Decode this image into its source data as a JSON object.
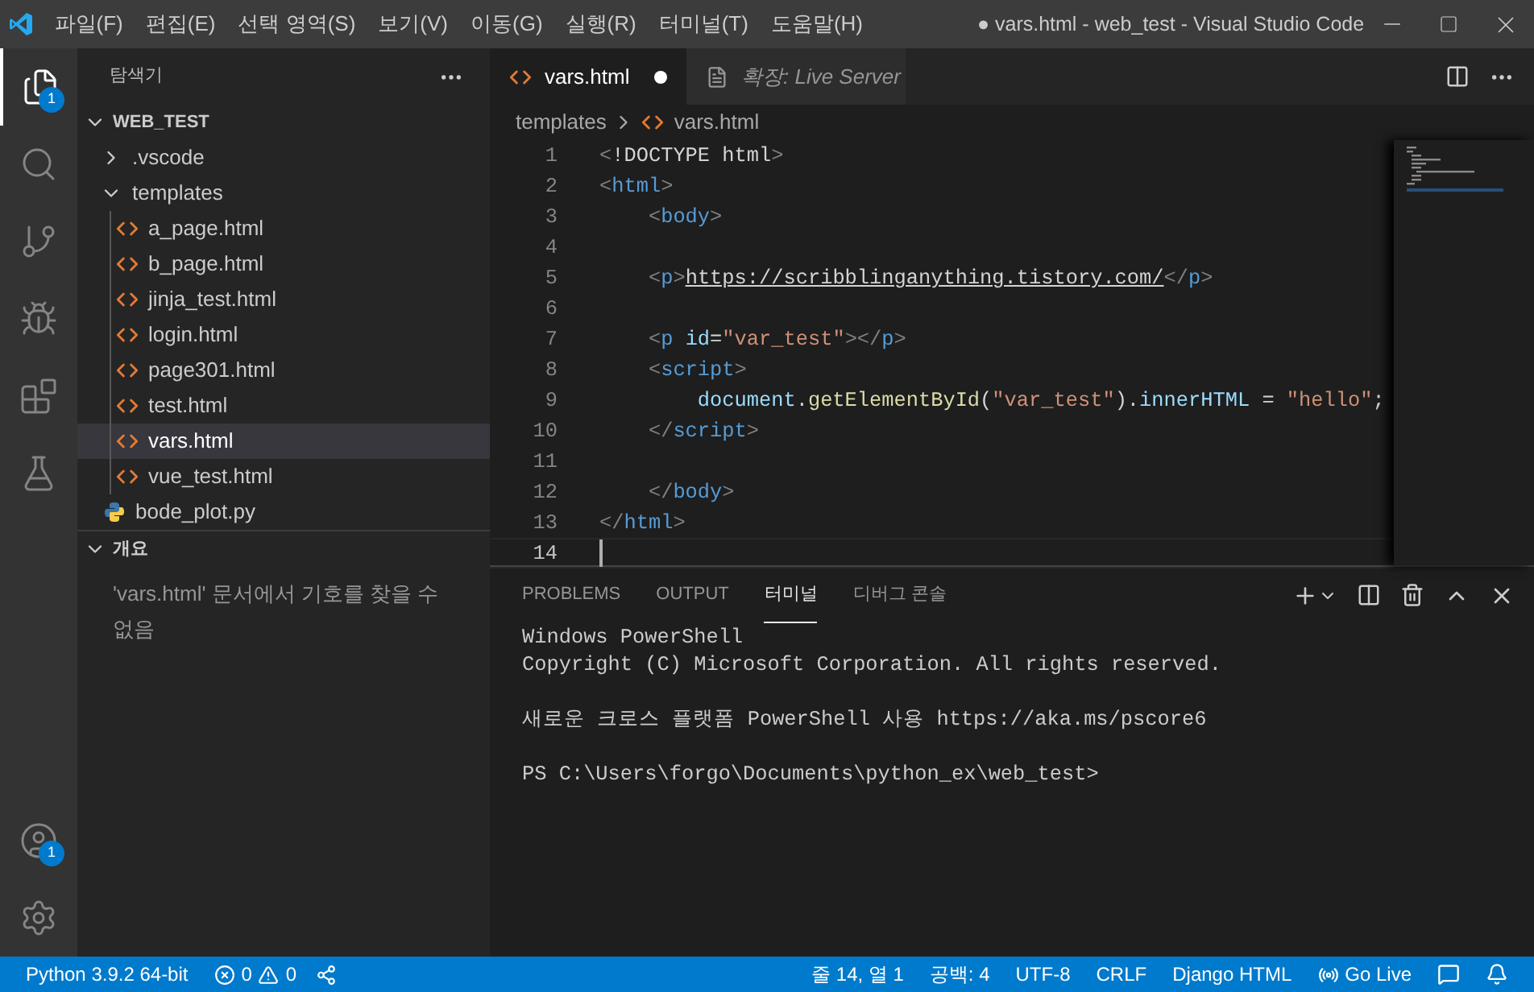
{
  "window": {
    "title": "● vars.html - web_test - Visual Studio Code"
  },
  "menu": [
    "파일(F)",
    "편집(E)",
    "선택 영역(S)",
    "보기(V)",
    "이동(G)",
    "실행(R)",
    "터미널(T)",
    "도움말(H)"
  ],
  "activity_bar": {
    "top": [
      {
        "kind": "explorer",
        "selected": true,
        "badge": "1"
      },
      {
        "kind": "search",
        "selected": false
      },
      {
        "kind": "source-control",
        "selected": false
      },
      {
        "kind": "run-debug",
        "selected": false
      },
      {
        "kind": "extensions",
        "selected": false
      },
      {
        "kind": "testing",
        "selected": false
      }
    ],
    "bottom": [
      {
        "kind": "account",
        "selected": false,
        "badge": "1"
      },
      {
        "kind": "settings",
        "selected": false
      }
    ]
  },
  "sidebar": {
    "title": "탐색기",
    "tree": {
      "label": "WEB_TEST",
      "expanded": true,
      "children": [
        {
          "label": ".vscode",
          "kind": "folder",
          "expanded": false,
          "selected": false
        },
        {
          "label": "templates",
          "kind": "folder",
          "expanded": true,
          "selected": false,
          "children": [
            {
              "label": "a_page.html",
              "kind": "html",
              "selected": false
            },
            {
              "label": "b_page.html",
              "kind": "html",
              "selected": false
            },
            {
              "label": "jinja_test.html",
              "kind": "html",
              "selected": false
            },
            {
              "label": "login.html",
              "kind": "html",
              "selected": false
            },
            {
              "label": "page301.html",
              "kind": "html",
              "selected": false
            },
            {
              "label": "test.html",
              "kind": "html",
              "selected": false
            },
            {
              "label": "vars.html",
              "kind": "html",
              "selected": true
            },
            {
              "label": "vue_test.html",
              "kind": "html",
              "selected": false
            }
          ]
        },
        {
          "label": "bode_plot.py",
          "kind": "python",
          "selected": false
        }
      ]
    },
    "outline": {
      "title": "개요",
      "expanded": true,
      "message": "'vars.html' 문서에서 기호를 찾을 수 없음"
    }
  },
  "editor_tabs": [
    {
      "label": "vars.html",
      "kind": "html",
      "selected": true,
      "dirty": true,
      "preview": false
    },
    {
      "label": "확장: Live Server",
      "kind": "extension",
      "selected": false,
      "dirty": false,
      "preview": true
    }
  ],
  "breadcrumbs": [
    {
      "label": "templates",
      "kind": "folder"
    },
    {
      "label": "vars.html",
      "kind": "html"
    }
  ],
  "code": [
    {
      "number": "1",
      "tokens": [
        {
          "text": "<",
          "kind": "punct"
        },
        {
          "text": "!DOCTYPE html",
          "kind": "text"
        },
        {
          "text": ">",
          "kind": "punct"
        }
      ]
    },
    {
      "number": "2",
      "tokens": [
        {
          "text": "<",
          "kind": "punct"
        },
        {
          "text": "html",
          "kind": "tag"
        },
        {
          "text": ">",
          "kind": "punct"
        }
      ]
    },
    {
      "number": "3",
      "tokens": [
        {
          "text": "    <",
          "kind": "punct"
        },
        {
          "text": "body",
          "kind": "tag"
        },
        {
          "text": ">",
          "kind": "punct"
        }
      ]
    },
    {
      "number": "4"
    },
    {
      "number": "5",
      "tokens": [
        {
          "text": "    <",
          "kind": "punct"
        },
        {
          "text": "p",
          "kind": "tag"
        },
        {
          "text": ">",
          "kind": "punct"
        },
        {
          "text": "https://scribblinganything.tistory.com/",
          "kind": "link"
        },
        {
          "text": "</",
          "kind": "punct"
        },
        {
          "text": "p",
          "kind": "tag"
        },
        {
          "text": ">",
          "kind": "punct"
        }
      ]
    },
    {
      "number": "6"
    },
    {
      "number": "7",
      "tokens": [
        {
          "text": "    <",
          "kind": "punct"
        },
        {
          "text": "p",
          "kind": "tag"
        },
        {
          "text": " id",
          "kind": "attr"
        },
        {
          "text": "=",
          "kind": "text"
        },
        {
          "text": "\"var_test\"",
          "kind": "string"
        },
        {
          "text": "></",
          "kind": "punct"
        },
        {
          "text": "p",
          "kind": "tag"
        },
        {
          "text": ">",
          "kind": "punct"
        }
      ]
    },
    {
      "number": "8",
      "tokens": [
        {
          "text": "    <",
          "kind": "punct"
        },
        {
          "text": "script",
          "kind": "tag"
        },
        {
          "text": ">",
          "kind": "punct"
        }
      ]
    },
    {
      "number": "9",
      "tokens": [
        {
          "text": "        document",
          "kind": "var"
        },
        {
          "text": ".",
          "kind": "text"
        },
        {
          "text": "getElementById",
          "kind": "func"
        },
        {
          "text": "(",
          "kind": "text"
        },
        {
          "text": "\"var_test\"",
          "kind": "string"
        },
        {
          "text": ").",
          "kind": "text"
        },
        {
          "text": "innerHTML",
          "kind": "var"
        },
        {
          "text": " = ",
          "kind": "text"
        },
        {
          "text": "\"hello\"",
          "kind": "string"
        },
        {
          "text": ";",
          "kind": "text"
        }
      ]
    },
    {
      "number": "10",
      "tokens": [
        {
          "text": "    </",
          "kind": "punct"
        },
        {
          "text": "script",
          "kind": "tag"
        },
        {
          "text": ">",
          "kind": "punct"
        }
      ]
    },
    {
      "number": "11"
    },
    {
      "number": "12",
      "tokens": [
        {
          "text": "    </",
          "kind": "punct"
        },
        {
          "text": "body",
          "kind": "tag"
        },
        {
          "text": ">",
          "kind": "punct"
        }
      ]
    },
    {
      "number": "13",
      "tokens": [
        {
          "text": "</",
          "kind": "punct"
        },
        {
          "text": "html",
          "kind": "tag"
        },
        {
          "text": ">",
          "kind": "punct"
        }
      ]
    },
    {
      "number": "14",
      "current": true
    }
  ],
  "panel": {
    "tabs": [
      {
        "label": "PROBLEMS",
        "selected": false
      },
      {
        "label": "OUTPUT",
        "selected": false
      },
      {
        "label": "터미널",
        "selected": true
      },
      {
        "label": "디버그 콘솔",
        "selected": false
      }
    ],
    "terminal": [
      [
        "Windows PowerShell",
        "Copyright (C) Microsoft Corporation. All rights reserved."
      ],
      [
        "새로운 크로스 플랫폼 PowerShell 사용 https://aka.ms/pscore6"
      ],
      [
        "PS C:\\Users\\forgo\\Documents\\python_ex\\web_test>"
      ]
    ]
  },
  "status_bar": {
    "python": "Python 3.9.2 64-bit",
    "errors": "0",
    "warnings": "0",
    "position": "줄 14, 열 1",
    "spaces": "공백: 4",
    "encoding": "UTF-8",
    "eol": "CRLF",
    "language": "Django HTML",
    "go_live": "Go Live"
  }
}
